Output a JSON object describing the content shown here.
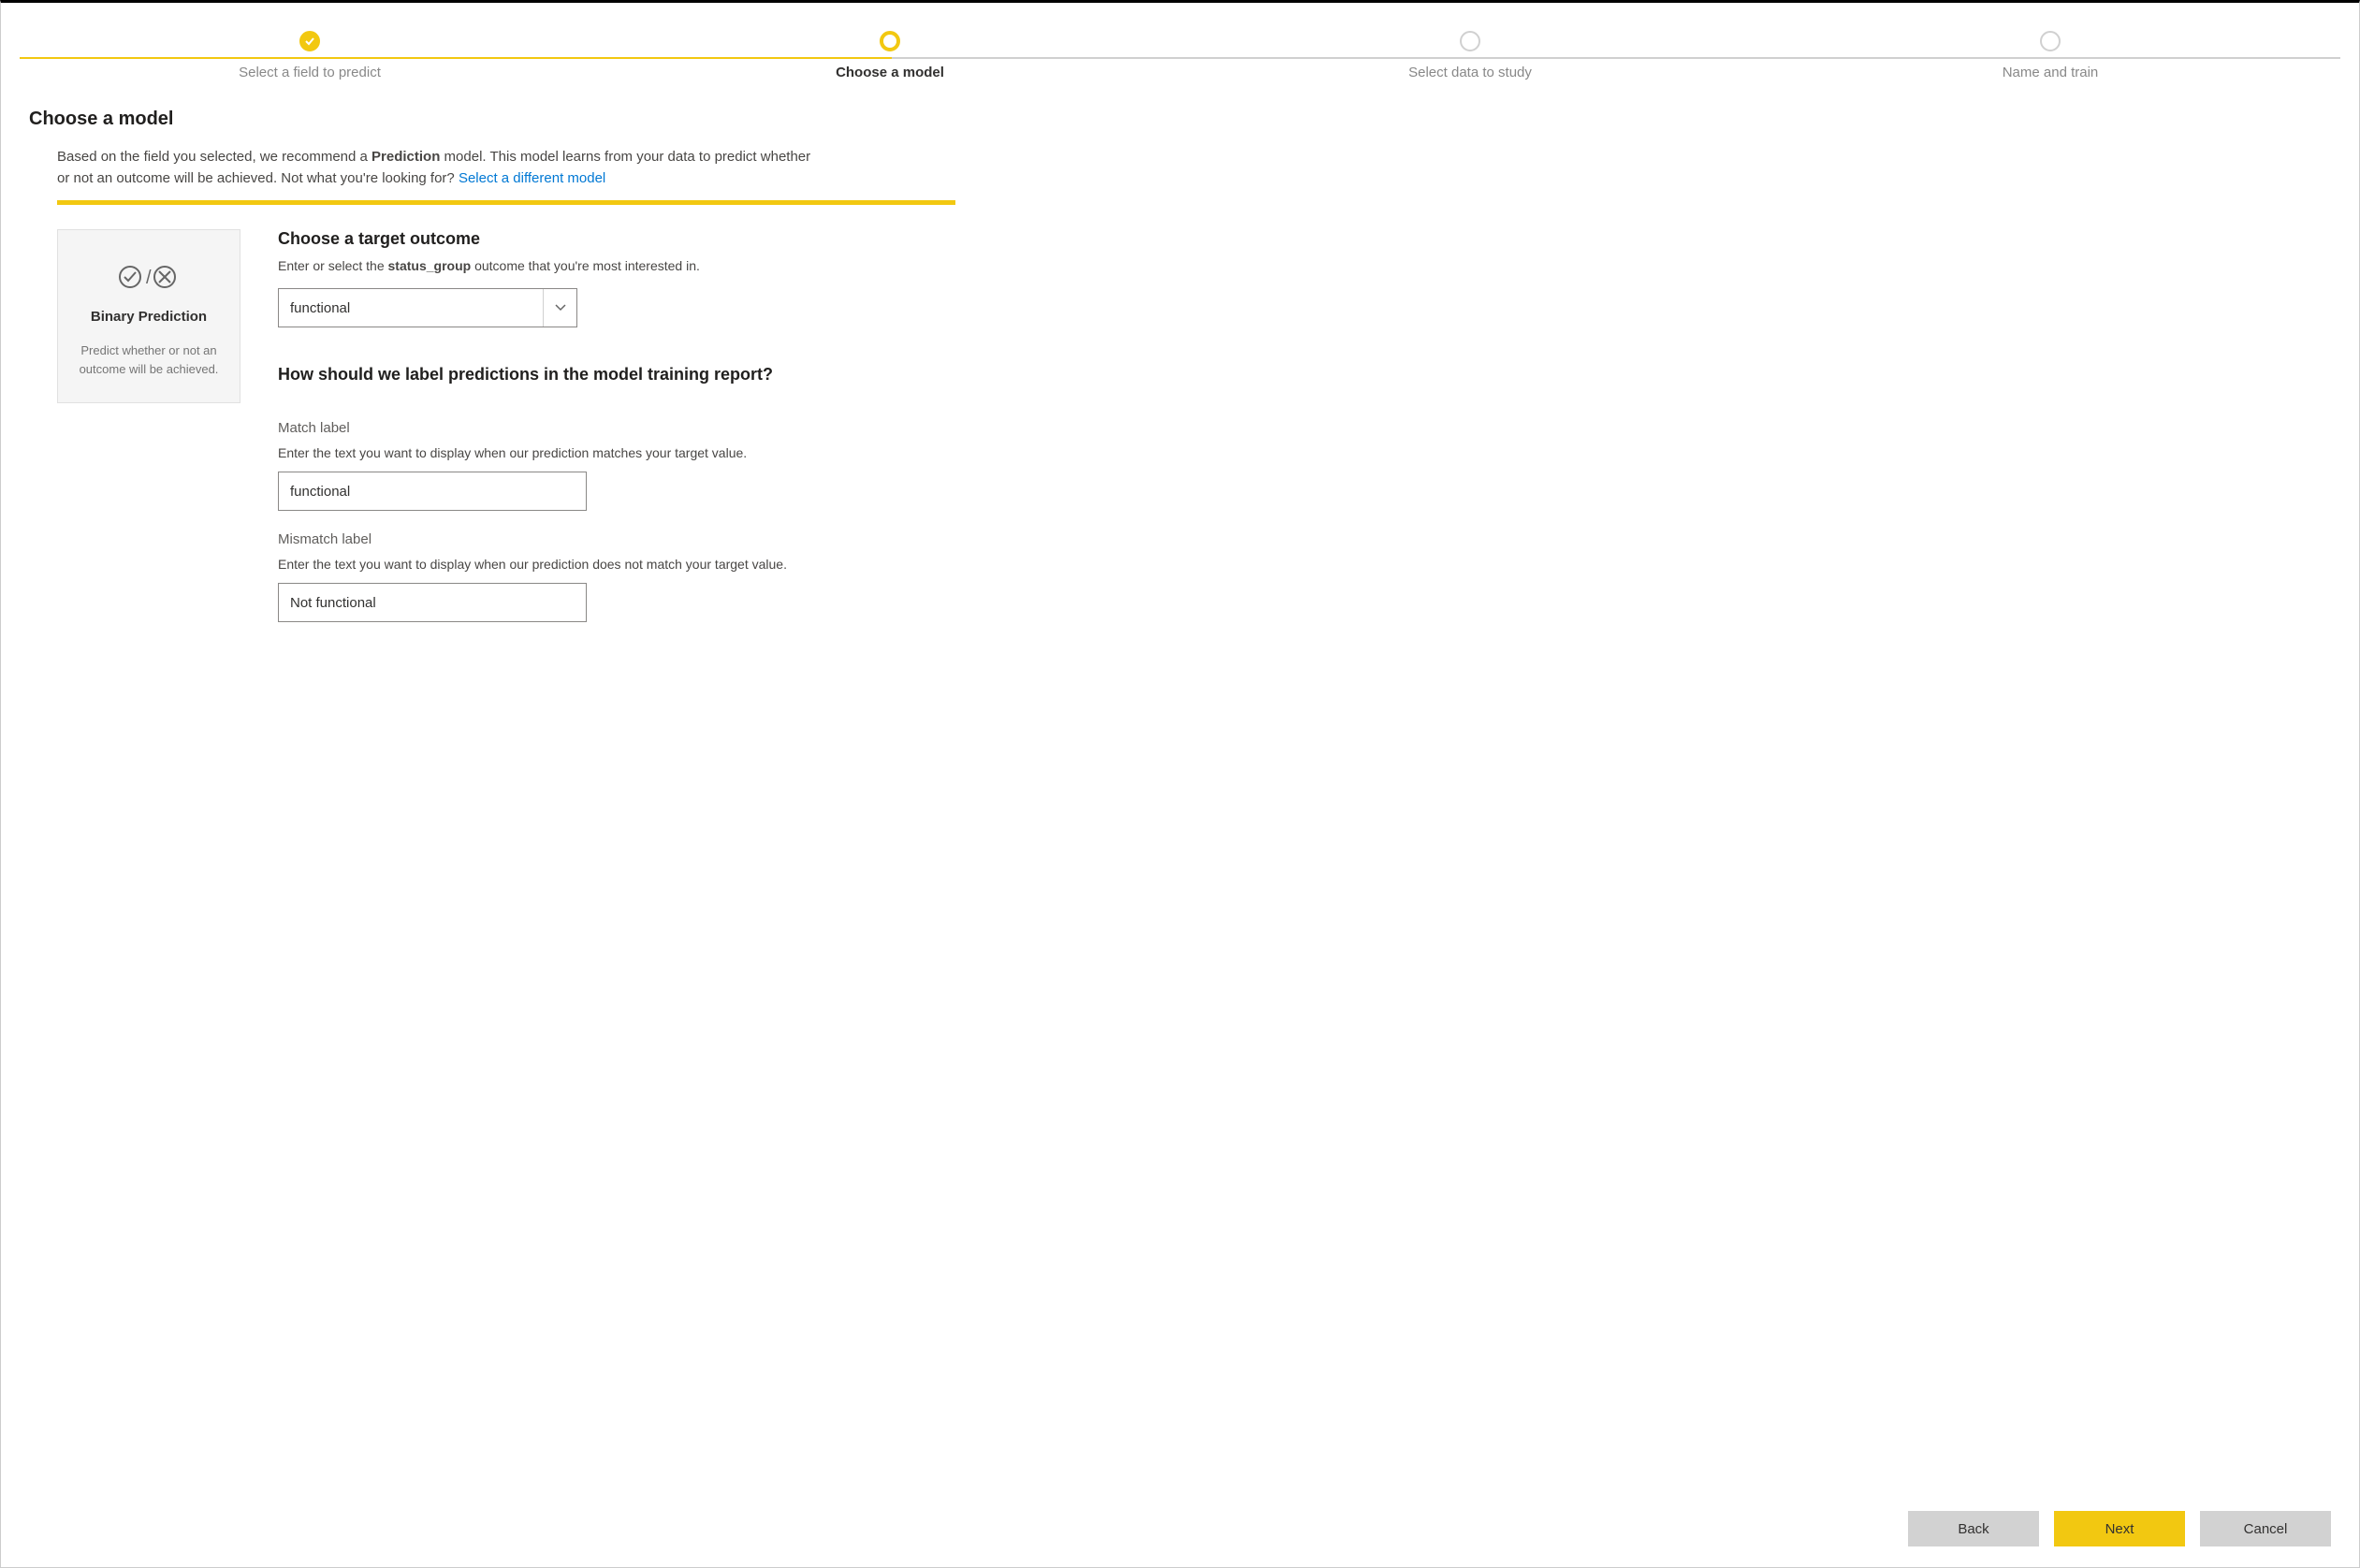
{
  "stepper": {
    "steps": [
      {
        "label": "Select a field to predict",
        "state": "completed"
      },
      {
        "label": "Choose a model",
        "state": "current"
      },
      {
        "label": "Select data to study",
        "state": "upcoming"
      },
      {
        "label": "Name and train",
        "state": "upcoming"
      }
    ]
  },
  "page": {
    "title": "Choose a model",
    "description_prefix": "Based on the field you selected, we recommend a ",
    "description_model_bold": "Prediction",
    "description_middle": " model. This model learns from your data to predict whether or not an outcome will be achieved. Not what you're looking for? ",
    "description_link": "Select a different model"
  },
  "model_card": {
    "title": "Binary Prediction",
    "description": "Predict whether or not an outcome will be achieved."
  },
  "target_section": {
    "heading": "Choose a target outcome",
    "sub_prefix": "Enter or select the ",
    "sub_bold": "status_group",
    "sub_suffix": " outcome that you're most interested in.",
    "selected_value": "functional"
  },
  "label_section": {
    "heading": "How should we label predictions in the model training report?",
    "match": {
      "label": "Match label",
      "help": "Enter the text you want to display when our prediction matches your target value.",
      "value": "functional"
    },
    "mismatch": {
      "label": "Mismatch label",
      "help": "Enter the text you want to display when our prediction does not match your target value.",
      "value": "Not functional"
    }
  },
  "footer": {
    "back": "Back",
    "next": "Next",
    "cancel": "Cancel"
  }
}
